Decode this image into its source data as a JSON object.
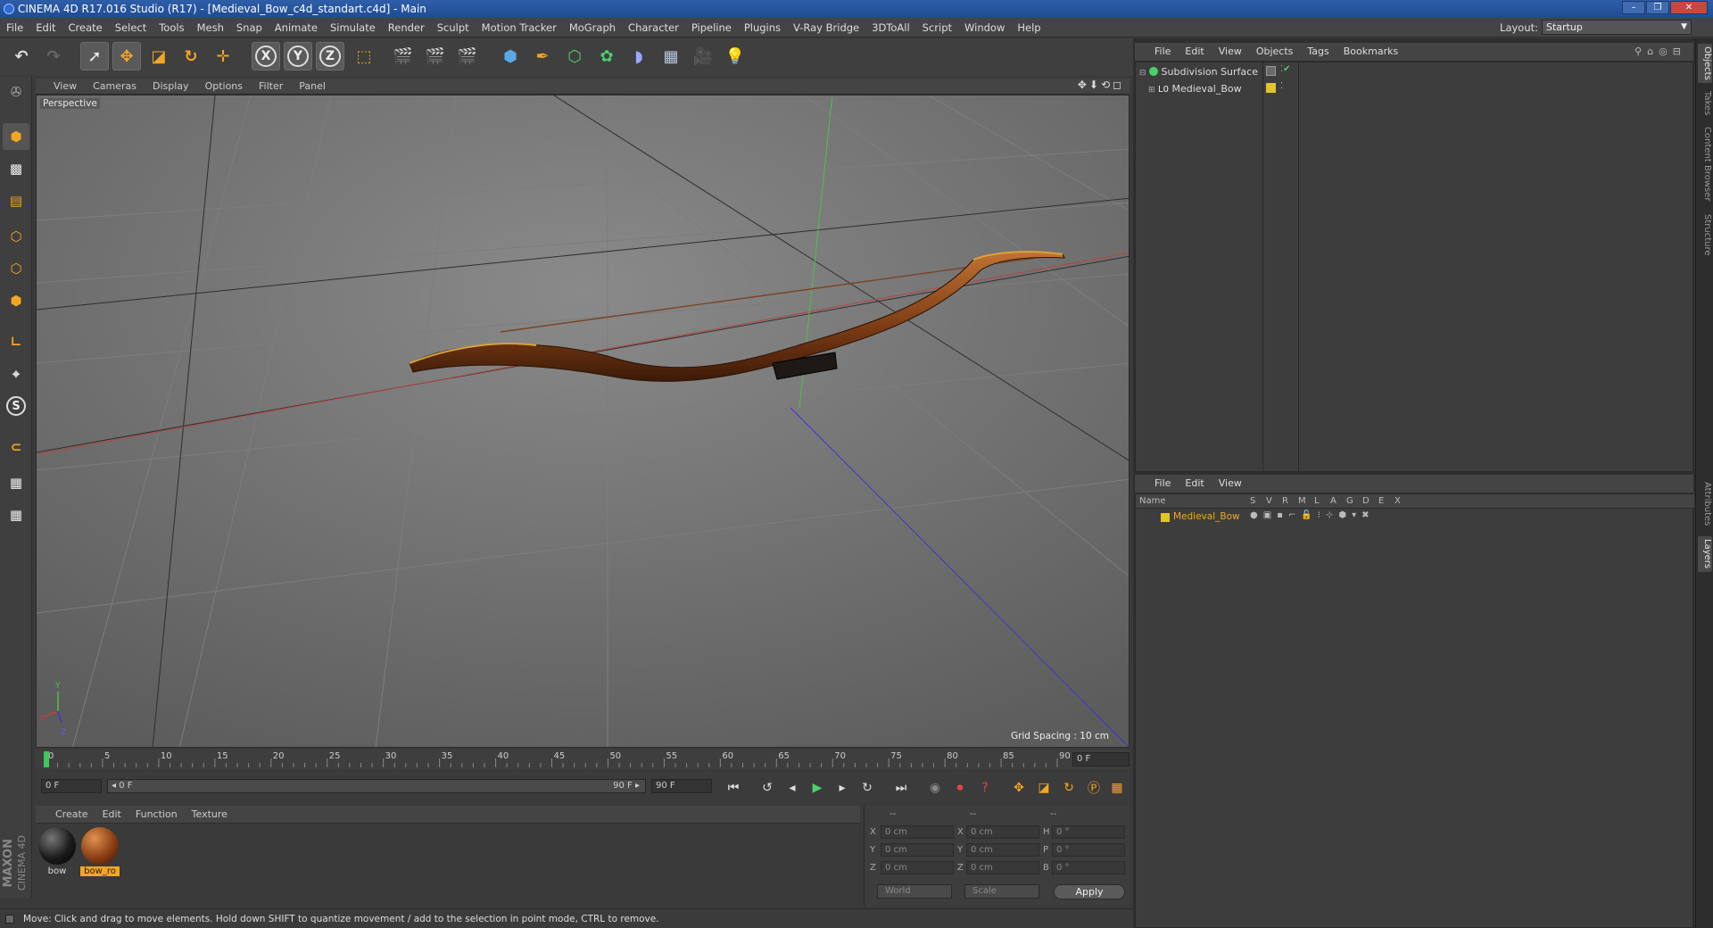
{
  "window": {
    "title": "CINEMA 4D R17.016 Studio (R17) - [Medieval_Bow_c4d_standart.c4d] - Main",
    "min": "–",
    "max": "❐",
    "close": "✕"
  },
  "menu": [
    "File",
    "Edit",
    "Create",
    "Select",
    "Tools",
    "Mesh",
    "Snap",
    "Animate",
    "Simulate",
    "Render",
    "Sculpt",
    "Motion Tracker",
    "MoGraph",
    "Character",
    "Pipeline",
    "Plugins",
    "V-Ray Bridge",
    "3DToAll",
    "Script",
    "Window",
    "Help"
  ],
  "layout": {
    "label": "Layout:",
    "value": "Startup"
  },
  "toolbar": {
    "x": "X",
    "y": "Y",
    "z": "Z"
  },
  "viewport": {
    "menu": [
      "View",
      "Cameras",
      "Display",
      "Options",
      "Filter",
      "Panel"
    ],
    "camera_label": "Perspective",
    "grid_spacing": "Grid Spacing : 10 cm"
  },
  "timeline": {
    "ticks": [
      "0",
      "5",
      "10",
      "15",
      "20",
      "25",
      "30",
      "35",
      "40",
      "45",
      "50",
      "55",
      "60",
      "65",
      "70",
      "75",
      "80",
      "85",
      "90"
    ],
    "current_frame": "0 F",
    "start": "0 F",
    "range_start": "◂ 0 F",
    "range_end": "90 F ▸",
    "end": "90 F"
  },
  "materials": {
    "menu": [
      "Create",
      "Edit",
      "Function",
      "Texture"
    ],
    "items": [
      {
        "name": "bow",
        "color": "#1b1b1b"
      },
      {
        "name": "bow_ro",
        "color": "#8a3f14"
      }
    ]
  },
  "coords": {
    "headers": [
      "--",
      "--",
      "--"
    ],
    "rows": [
      {
        "a": "X",
        "av": "0 cm",
        "b": "X",
        "bv": "0 cm",
        "c": "H",
        "cv": "0 °"
      },
      {
        "a": "Y",
        "av": "0 cm",
        "b": "Y",
        "bv": "0 cm",
        "c": "P",
        "cv": "0 °"
      },
      {
        "a": "Z",
        "av": "0 cm",
        "b": "Z",
        "bv": "0 cm",
        "c": "B",
        "cv": "0 °"
      }
    ],
    "world": "World",
    "scale": "Scale",
    "apply": "Apply"
  },
  "logo": {
    "brand": "MAXON",
    "product": "CINEMA 4D"
  },
  "status": "Move: Click and drag to move elements. Hold down SHIFT to quantize movement / add to the selection in point mode, CTRL to remove.",
  "objects": {
    "menu": [
      "File",
      "Edit",
      "View",
      "Objects",
      "Tags",
      "Bookmarks"
    ],
    "items": [
      {
        "name": "Subdivision Surface"
      },
      {
        "name": "Medieval_Bow"
      }
    ]
  },
  "layers": {
    "menu": [
      "File",
      "Edit",
      "View"
    ],
    "columns": [
      "Name",
      "S",
      "V",
      "R",
      "M",
      "L",
      "A",
      "G",
      "D",
      "E",
      "X"
    ],
    "items": [
      {
        "name": "Medieval_Bow",
        "color": "#e0c620"
      }
    ]
  },
  "side_tabs": [
    "Objects",
    "Takes",
    "Content Browser",
    "Structure",
    "Attributes",
    "Layers"
  ],
  "colors": {
    "accent": "#f4a623",
    "x_axis": "#c43b3b",
    "y_axis": "#3bbf3b",
    "z_axis": "#3b3bd6"
  }
}
